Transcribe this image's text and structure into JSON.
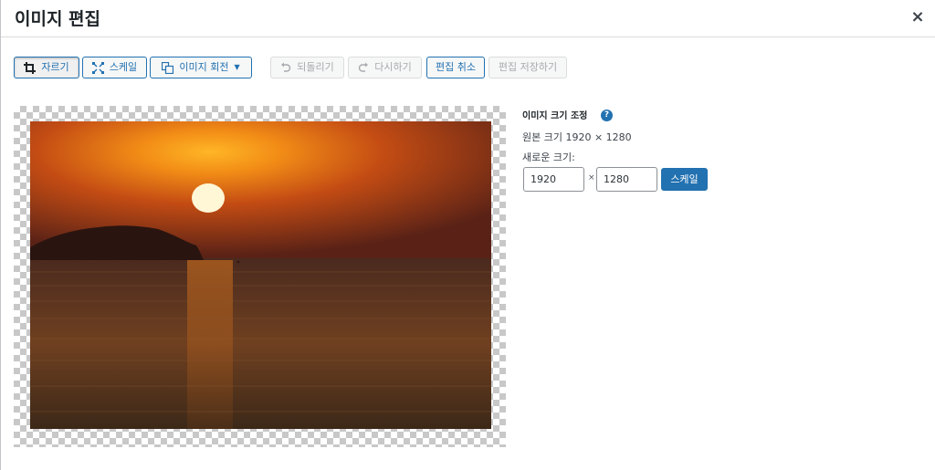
{
  "header": {
    "title": "이미지 편집",
    "close_label": "×"
  },
  "toolbar": {
    "crop_label": "자르기",
    "scale_label": "스케일",
    "rotate_label": "이미지 회전",
    "rotate_caret": "▼",
    "undo_label": "되돌리기",
    "redo_label": "다시하기",
    "cancel_label": "편집 취소",
    "save_label": "편집 저장하기"
  },
  "scale_panel": {
    "title": "이미지 크기 조정",
    "help_icon": "?",
    "original_size": "원본 크기 1920 × 1280",
    "new_size_label": "새로운 크기:",
    "width_value": "1920",
    "times": "×",
    "height_value": "1280",
    "scale_button": "스케일"
  },
  "icons": {
    "crop": "crop-icon",
    "scale": "scale-icon",
    "rotate": "rotate-icon",
    "undo": "undo-icon",
    "redo": "redo-icon",
    "help": "help-icon",
    "close": "close-icon"
  },
  "colors": {
    "accent": "#2271b1",
    "disabled": "#a7aaad"
  }
}
